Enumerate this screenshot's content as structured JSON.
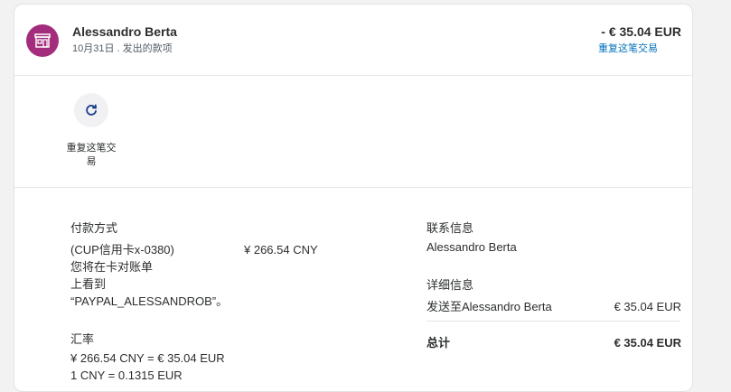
{
  "header": {
    "name": "Alessandro Berta",
    "subline": "10月31日 . 发出的款项",
    "amount": "- € 35.04 EUR",
    "repeat_link": "重复这笔交易",
    "avatar_icon": "store-icon"
  },
  "actions": {
    "repeat_label": "重复这笔交易",
    "repeat_icon": "refresh-icon"
  },
  "payment": {
    "heading": "付款方式",
    "card": "(CUP信用卡x-0380)",
    "card_amount": "¥ 266.54 CNY",
    "statement_line1": "您将在卡对账单",
    "statement_line2": "上看到",
    "statement_line3": "“PAYPAL_ALESSANDROB”。",
    "rate_heading": "汇率",
    "rate_line1": "¥ 266.54 CNY = € 35.04 EUR",
    "rate_line2": "1 CNY = 0.1315 EUR"
  },
  "contact": {
    "heading": "联系信息",
    "name": "Alessandro Berta",
    "details_heading": "详细信息",
    "sent_to": "发送至Alessandro Berta",
    "sent_amount": "€ 35.04 EUR",
    "total_label": "总计",
    "total_amount": "€ 35.04 EUR"
  },
  "colors": {
    "avatar": "#a32c7c",
    "link": "#0070ba",
    "icon": "#1a3e8c"
  }
}
